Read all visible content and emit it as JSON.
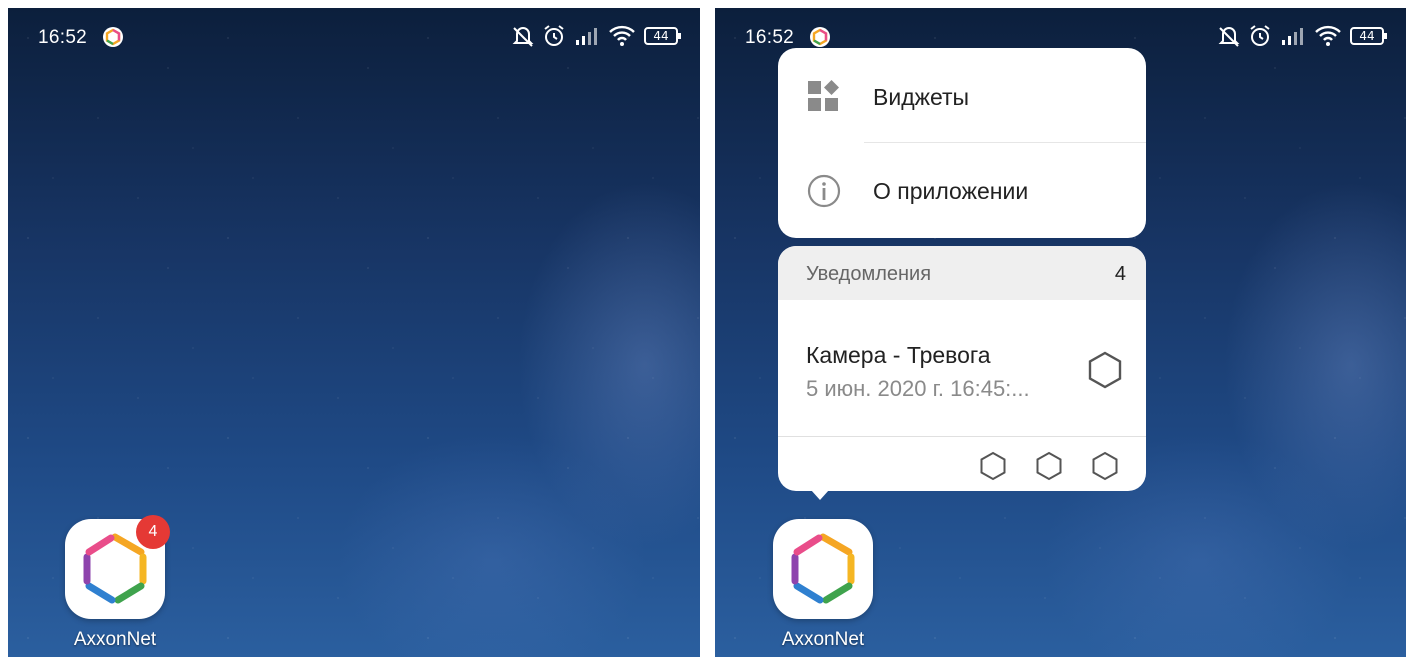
{
  "colors": {
    "badge": "#e53935",
    "card_background": "#ffffff",
    "notification_header_bg": "#efefef",
    "wallpaper_top": "#0c1f3c",
    "wallpaper_bottom": "#2b5f9f"
  },
  "left_screen": {
    "status_bar": {
      "time": "16:52",
      "battery": "44"
    },
    "app": {
      "label": "AxxonNet",
      "badge_count": "4",
      "icon": "axxonnet-hexagon-icon"
    }
  },
  "right_screen": {
    "status_bar": {
      "time": "16:52",
      "battery": "44"
    },
    "popup_menu": {
      "items": [
        {
          "label": "Виджеты",
          "icon": "widgets-icon"
        },
        {
          "label": "О приложении",
          "icon": "info-icon"
        }
      ]
    },
    "notifications": {
      "header_label": "Уведомления",
      "count": "4",
      "item": {
        "title": "Камера - Тревога",
        "subtitle": "5 июн. 2020 г. 16:45:..."
      },
      "stacked_icons": [
        "hexagon-icon",
        "hexagon-icon",
        "hexagon-icon"
      ]
    },
    "app": {
      "label": "AxxonNet",
      "icon": "axxonnet-hexagon-icon"
    }
  }
}
